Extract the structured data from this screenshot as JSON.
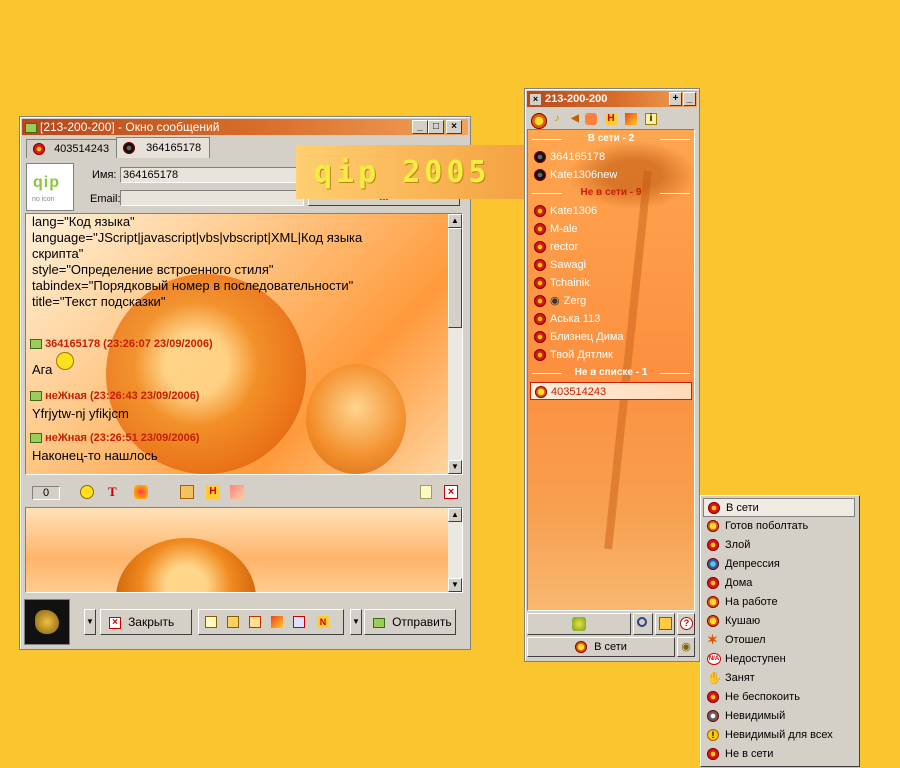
{
  "chat_window": {
    "title": "[213-200-200] - Окно сообщений",
    "tabs": [
      {
        "label": "403514243"
      },
      {
        "label": "364165178"
      }
    ],
    "logo_sub": "no icon",
    "name_label": "Имя:",
    "name_value": "364165178",
    "email_label": "Email:",
    "email_value": "",
    "email_btn": "...",
    "code_lines": [
      "lang=\"Код языка\"",
      "language=\"JScript|javascript|vbs|vbscript|XML|Код языка",
      "скрипта\"",
      "style=\"Определение встроенного стиля\"",
      "tabindex=\"Порядковый номер в последовательности\"",
      "title=\"Текст подсказки\""
    ],
    "messages": [
      {
        "sender": "364165178 (23:26:07 23/09/2006)",
        "text": "Ага"
      },
      {
        "sender": "неЖная (23:26:43 23/09/2006)",
        "text": "Yfrjytw-nj yfikjcm"
      },
      {
        "sender": "неЖная (23:26:51 23/09/2006)",
        "text": "Наконец-то нашлось"
      }
    ],
    "char_count": "0",
    "close_label": "Закрыть",
    "send_label": "Отправить"
  },
  "banner": {
    "text": "qip 2005"
  },
  "contact_list": {
    "title": "213-200-200",
    "groups": [
      {
        "label": "В сети - 2",
        "contacts": [
          "364165178",
          "Kate1306new"
        ]
      },
      {
        "label": "Не в сети - 9",
        "contacts": [
          "Kate1306",
          "M-ale",
          "rector",
          "Sawagi",
          "Tchainik",
          "Zerg",
          "Аська 113",
          "Близнец Дима",
          "Твой Дятлик"
        ]
      },
      {
        "label": "Не в списке - 1",
        "contacts": [
          "403514243"
        ]
      }
    ],
    "status_label": "В сети"
  },
  "status_menu": {
    "items": [
      "В сети",
      "Готов поболтать",
      "Злой",
      "Депрессия",
      "Дома",
      "На работе",
      "Кушаю",
      "Отошел",
      "Недоступен",
      "Занят",
      "Не беспокоить",
      "Невидимый",
      "Невидимый для всех",
      "Не в сети"
    ]
  },
  "colors": {
    "desktop": "#fbc52f",
    "accent": "#d96f2a",
    "sender_red": "#c81e00"
  }
}
